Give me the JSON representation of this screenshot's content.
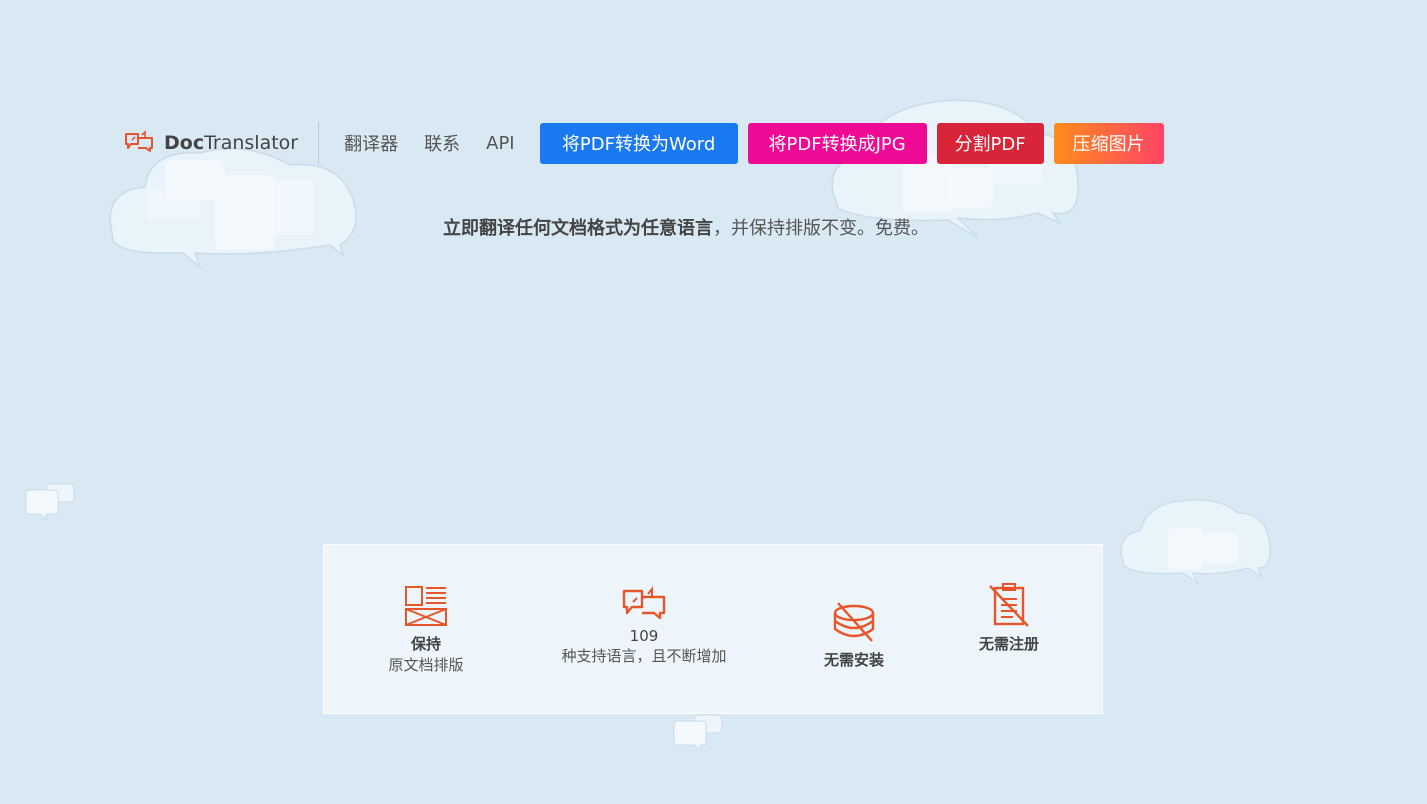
{
  "brand": {
    "name_bold": "Doc",
    "name_rest": "Translator",
    "icon": "speech-bubbles-icon"
  },
  "nav": {
    "translator": "翻译器",
    "contact": "联系",
    "api": "API"
  },
  "buttons": {
    "pdf_to_word": "将PDF转换为Word",
    "pdf_to_jpg": "将PDF转换成JPG",
    "split_pdf": "分割PDF",
    "compress_image": "压缩图片"
  },
  "tagline": {
    "bold": "立即翻译任何文档格式为任意语言",
    "rest": "，并保持排版不变。免费。"
  },
  "features": [
    {
      "icon": "layout-icon",
      "line1": "保持",
      "line2": "原文档排版"
    },
    {
      "icon": "translate-bubbles-icon",
      "line1": "109",
      "line2": "种支持语言，且不断增加"
    },
    {
      "icon": "no-install-icon",
      "line1": "无需安装"
    },
    {
      "icon": "no-registration-icon",
      "line1": "无需注册"
    }
  ],
  "colors": {
    "background": "#d8e9f4",
    "accent_orange": "#e8552a",
    "btn_word": "#1a78f0",
    "btn_jpg": "#ee0a95",
    "btn_split": "#d9253a",
    "btn_compress_start": "#ff8c1a",
    "btn_compress_end": "#ff4466"
  }
}
